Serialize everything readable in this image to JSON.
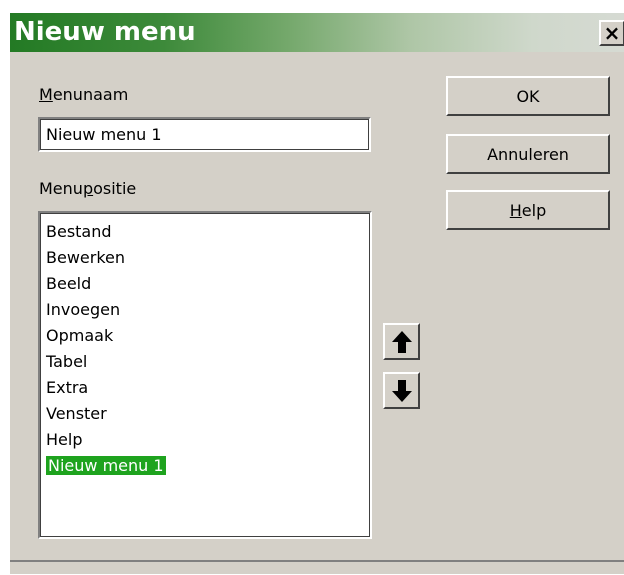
{
  "window": {
    "title": "Nieuw menu",
    "close_glyph": "×"
  },
  "menu_name": {
    "label_first": "M",
    "label_rest": "enunaam",
    "value": "Nieuw menu 1"
  },
  "menu_position": {
    "label_before": "Menu",
    "label_accel": "p",
    "label_after": "ositie",
    "items": [
      "Bestand",
      "Bewerken",
      "Beeld",
      "Invoegen",
      "Opmaak",
      "Tabel",
      "Extra",
      "Venster",
      "Help",
      "Nieuw menu 1"
    ],
    "selected": "Nieuw menu 1"
  },
  "buttons": {
    "ok": "OK",
    "cancel": "Annuleren",
    "help_first": "H",
    "help_rest": "elp"
  },
  "icons": {
    "up": "arrow-up-icon",
    "down": "arrow-down-icon"
  },
  "colors": {
    "title_green": "#237a24",
    "selection": "#1ea31e",
    "dialog_bg": "#d4d0c8"
  }
}
